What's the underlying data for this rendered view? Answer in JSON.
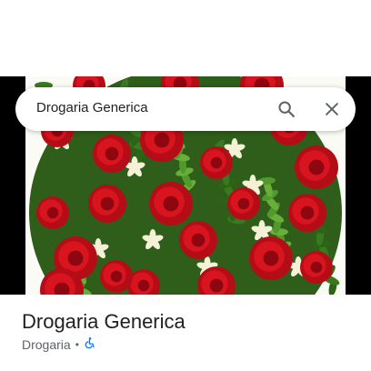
{
  "search": {
    "query": "Drogaria Generica"
  },
  "icons": {
    "search": "search-icon",
    "close": "close-icon",
    "accessibility": "wheelchair-icon"
  },
  "place": {
    "title": "Drogaria Generica",
    "category": "Drogaria",
    "separator": "•"
  },
  "colors": {
    "accessibility": "#1a73e8",
    "flower": "#c8101a",
    "leaf": "#3a7a1e"
  }
}
